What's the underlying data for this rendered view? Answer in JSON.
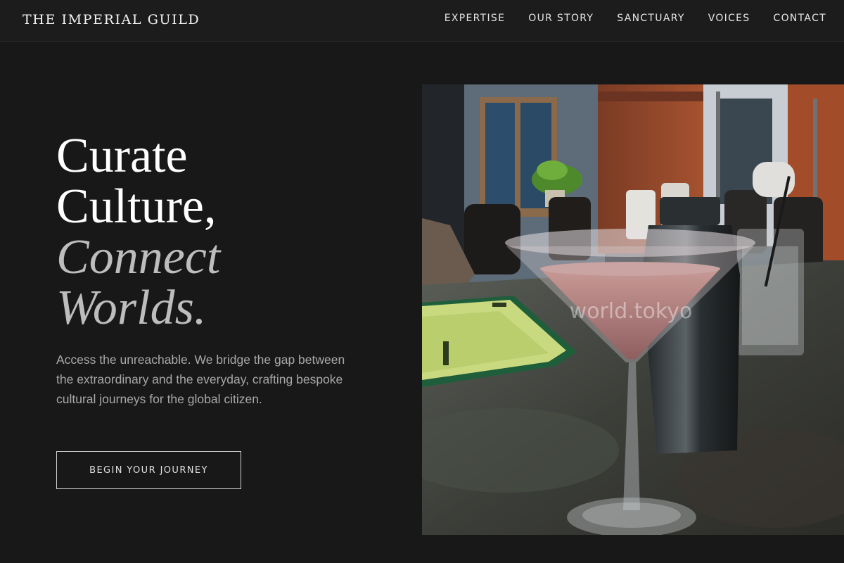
{
  "header": {
    "logo": "THE IMPERIAL GUILD",
    "nav": [
      "EXPERTISE",
      "OUR STORY",
      "SANCTUARY",
      "VOICES",
      "CONTACT"
    ]
  },
  "hero": {
    "title_lines": [
      "Curate",
      "Culture,"
    ],
    "title_accent_lines": [
      "Connect",
      "Worlds."
    ],
    "description": "Access the unreachable. We bridge the gap between the extraordinary and the everyday, crafting bespoke cultural journeys for the global citizen.",
    "cta_label": "BEGIN YOUR JOURNEY",
    "image_watermark": "world.tokyo"
  },
  "colors": {
    "background": "#181818",
    "header": "#1c1c1c",
    "text_primary": "#ffffff",
    "text_muted": "#a8a8a8",
    "accent_italic": "#bdbdbd"
  }
}
